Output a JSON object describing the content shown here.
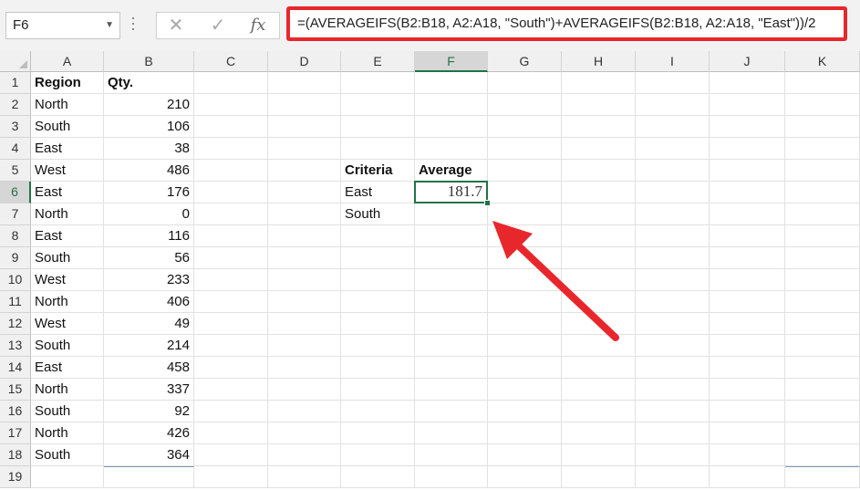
{
  "name_box": {
    "value": "F6"
  },
  "formula_bar": {
    "cancel_icon": "close-icon",
    "enter_icon": "check-icon",
    "fx_label": "fx",
    "formula": "=(AVERAGEIFS(B2:B18, A2:A18, \"South\")+AVERAGEIFS(B2:B18, A2:A18, \"East\"))/2",
    "highlight_color": "#e8272c"
  },
  "columns": [
    "A",
    "B",
    "C",
    "D",
    "E",
    "F",
    "G",
    "H",
    "I",
    "J",
    "K"
  ],
  "selected_column": "F",
  "selected_row": "6",
  "rows": [
    "1",
    "2",
    "3",
    "4",
    "5",
    "6",
    "7",
    "8",
    "9",
    "10",
    "11",
    "12",
    "13",
    "14",
    "15",
    "16",
    "17",
    "18",
    "19"
  ],
  "table": {
    "headers": {
      "region": "Region",
      "qty": "Qty."
    },
    "records": [
      {
        "region": "North",
        "qty": "210"
      },
      {
        "region": "South",
        "qty": "106"
      },
      {
        "region": "East",
        "qty": "38"
      },
      {
        "region": "West",
        "qty": "486"
      },
      {
        "region": "East",
        "qty": "176"
      },
      {
        "region": "North",
        "qty": "0"
      },
      {
        "region": "East",
        "qty": "116"
      },
      {
        "region": "South",
        "qty": "56"
      },
      {
        "region": "West",
        "qty": "233"
      },
      {
        "region": "North",
        "qty": "406"
      },
      {
        "region": "West",
        "qty": "49"
      },
      {
        "region": "South",
        "qty": "214"
      },
      {
        "region": "East",
        "qty": "458"
      },
      {
        "region": "North",
        "qty": "337"
      },
      {
        "region": "South",
        "qty": "92"
      },
      {
        "region": "North",
        "qty": "426"
      },
      {
        "region": "South",
        "qty": "364"
      }
    ]
  },
  "summary": {
    "criteria_header": "Criteria",
    "average_header": "Average",
    "criteria_1": "East",
    "criteria_2": "South",
    "result": "181.7"
  },
  "accent_color": "#217346",
  "arrow_color": "#e8272c"
}
